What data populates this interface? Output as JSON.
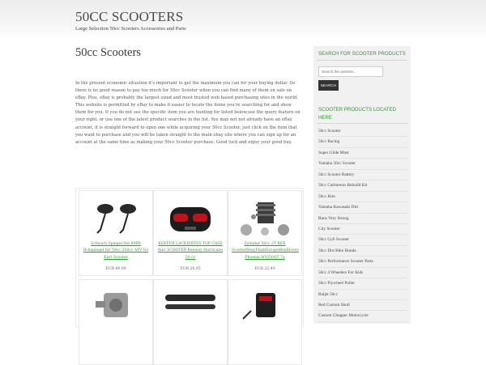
{
  "site": {
    "title": "50CC SCOOTERS",
    "tagline": "Large Selection 50cc Scooters Accessories and Parts"
  },
  "post": {
    "title": "50cc Scooters",
    "body": "In the present economic situation it's important to get the maximum you can for your buying dollar. So there is no good reason to pay too much for 50cc Scooter when you can find many of them on sale on eBay. Plus, eBay is probably the largest sized and most trusted web based purchasing sites in the world. This website is permitted by eBay to make it easier to locate the items you're searching for and show them for you. If you do not see the specific item you are hunting for listed below,use the query feature on your right, or use one of the latest product searches in the list. You may not not already have an eBay account, it is straight forward to open one while acquiring your 50cc Scooter, just click on the item that you want to purchase and you will be taken straight to the main ebay site where you can sign up for an account at the same time as making your 50cc Scooter purchase. Good luck and enjoy your good buy."
  },
  "products": [
    {
      "name": "Schwarz Spiegel Set 8MM Rckspiegel für 50cc 250cc ATV Go Kart Scooter",
      "price": "EUR 66,99",
      "icon": "mirror-set-icon"
    },
    {
      "name": "KOFFER LACKIERTES TOP CASE fuer SCOOTER Keeway Hurricane 50 cc",
      "price": "EUR 26,95",
      "icon": "top-case-icon"
    },
    {
      "name": "Zylinder 50cc 2T REX ScooterRexyFlashEscapeBoxRivero Phoenix WYJ50QT 7a",
      "price": "EUR 22,49",
      "icon": "cylinder-kit-icon"
    },
    {
      "name": "",
      "price": "",
      "icon": "carburetor-icon"
    },
    {
      "name": "",
      "price": "",
      "icon": "drive-belt-icon"
    },
    {
      "name": "",
      "price": "",
      "icon": "cdi-unit-icon"
    }
  ],
  "sidebar": {
    "search_title": "SEARCH FOR SCOOTER PRODUCTS",
    "search_placeholder": "Search this website...",
    "search_button": "SEARCH",
    "products_title": "SCOOTER PRODUCTS LOCATED HERE",
    "categories": [
      "50cc Scooter",
      "50cc Racing",
      "Super Glide Must",
      "Yamaha 50cc Scooter",
      "50cc Scooter Battery",
      "50cc Carburetor Rebuild Kit",
      "50cc Ktm",
      "Yamaha Kawasaki Dirt",
      "Runs Very Strong",
      "City Scooter",
      "50cc Gy6 Scooter",
      "50cc Dirt Bike Honda",
      "50cc Performance Scooter Parts",
      "50cc 4 Wheelers For Kids",
      "50cc Flywheel Puller",
      "Baljet 50cc",
      "Red Custom Skull",
      "Custom Chopper Motorcycle"
    ]
  },
  "colors": {
    "accent": "#3a8f3a",
    "link": "#2e9e2e",
    "button": "#333333"
  }
}
